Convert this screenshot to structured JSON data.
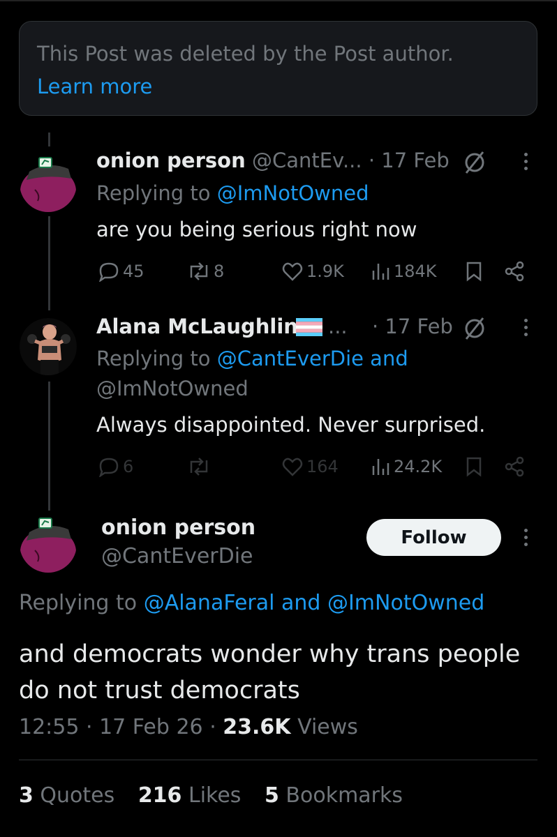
{
  "deleted_notice": {
    "text": "This Post was deleted by the Post author.",
    "link": "Learn more"
  },
  "replies": [
    {
      "name": "onion person",
      "handle": "@CantEv...",
      "date": "· 17 Feb",
      "replying_prefix": "Replying to",
      "replying_to": "@ImNotOwned",
      "text": "are you being serious right now",
      "stats": {
        "replies": "45",
        "reposts": "8",
        "likes": "1.9K",
        "views": "184K"
      }
    },
    {
      "name": "Alana McLaughlin",
      "handle": "...",
      "date": "· 17 Feb",
      "replying_prefix": "Replying to",
      "replying_to_1": "@CantEverDie and",
      "replying_to_2": "@ImNotOwned",
      "text": "Always disappointed. Never surprised.",
      "stats": {
        "replies": "6",
        "likes": "164",
        "views": "24.2K"
      }
    }
  ],
  "main_post": {
    "name": "onion person",
    "handle": "@CantEverDie",
    "follow_label": "Follow",
    "replying_prefix": "Replying to",
    "replying_to": "@AlanaFeral and @ImNotOwned",
    "text": "and democrats wonder why trans people do not trust democrats",
    "time": "12:55",
    "date": "17 Feb 26",
    "views_count": "23.6K",
    "views_label": "Views",
    "quotes_count": "3",
    "quotes_label": "Quotes",
    "likes_count": "216",
    "likes_label": "Likes",
    "bookmarks_count": "5",
    "bookmarks_label": "Bookmarks"
  },
  "colors": {
    "background": "#000000",
    "text_primary": "#e7e9ea",
    "text_secondary": "#71767b",
    "link": "#1d9bf0",
    "card": "#16181c",
    "border": "#2f3336",
    "avatar_onion": "#8e1f5f",
    "trans_blue": "#5bcefa",
    "trans_pink": "#f5a9b8"
  },
  "icons": [
    "reply-icon",
    "repost-icon",
    "like-icon",
    "views-icon",
    "bookmark-icon",
    "share-icon",
    "more-icon",
    "moderation-icon",
    "trans-flag-icon"
  ]
}
